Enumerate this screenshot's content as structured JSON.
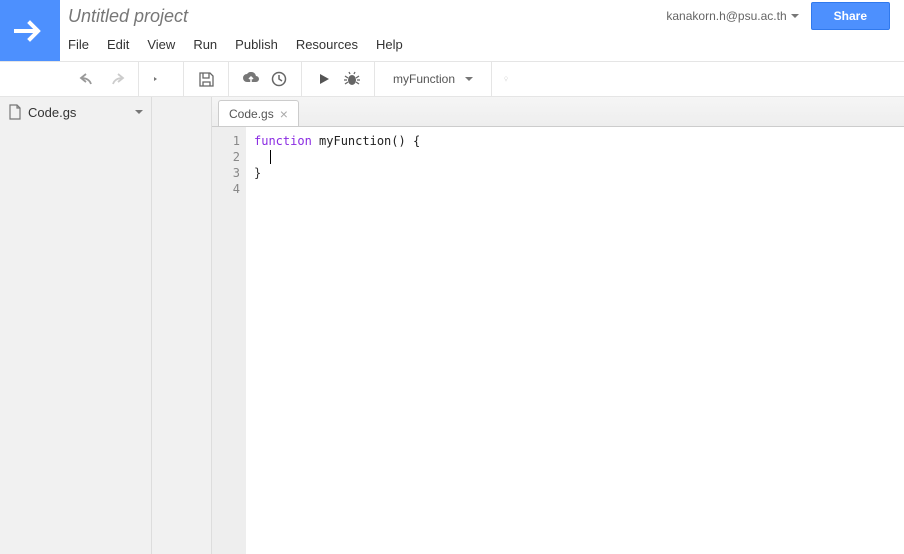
{
  "header": {
    "project_title": "Untitled project",
    "user_email": "kanakorn.h@psu.ac.th",
    "share_label": "Share"
  },
  "menu": {
    "file": "File",
    "edit": "Edit",
    "view": "View",
    "run": "Run",
    "publish": "Publish",
    "resources": "Resources",
    "help": "Help"
  },
  "toolbar": {
    "function_selected": "myFunction"
  },
  "sidebar": {
    "file_name": "Code.gs"
  },
  "editor": {
    "tab_label": "Code.gs",
    "line_numbers": [
      "1",
      "2",
      "3",
      "4"
    ],
    "code": {
      "kw_function": "function",
      "fn_name": " myFunction() {",
      "close_brace": "}"
    }
  }
}
